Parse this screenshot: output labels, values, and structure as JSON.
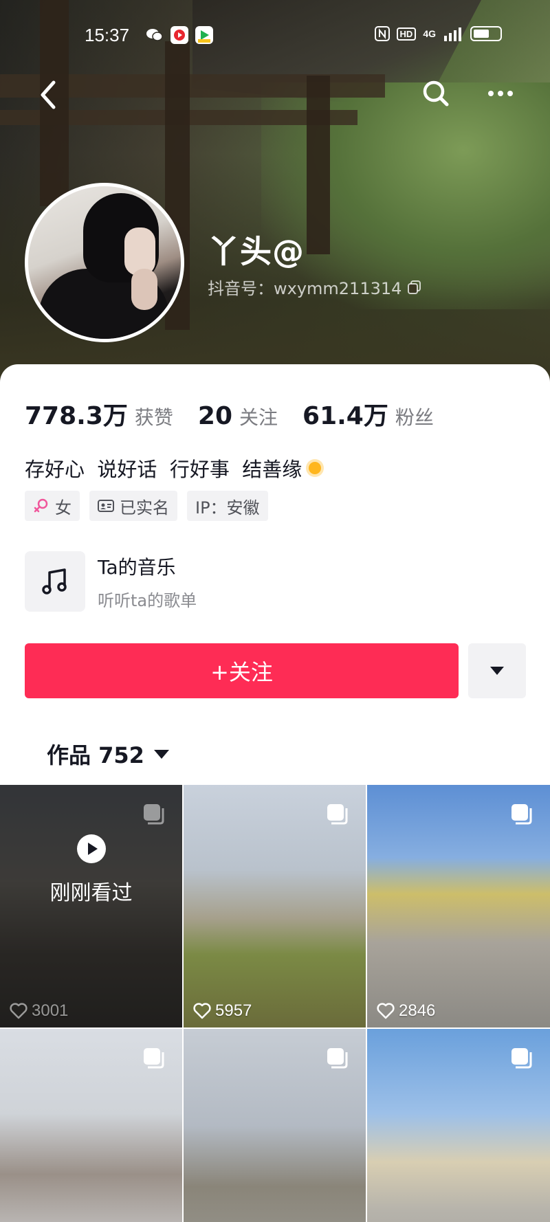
{
  "status_bar": {
    "time": "15:37",
    "network": "4G",
    "hd": "HD"
  },
  "profile": {
    "nickname": "丫头@",
    "douyin_id": "抖音号：wxymm211314",
    "stats": [
      {
        "value": "778.3万",
        "label": "获赞"
      },
      {
        "value": "20",
        "label": "关注"
      },
      {
        "value": "61.4万",
        "label": "粉丝"
      }
    ],
    "bio": "存好心  说好话  行好事  结善缘",
    "tags": [
      {
        "icon": "female-icon",
        "label": "女"
      },
      {
        "icon": "id-card-icon",
        "label": "已实名"
      },
      {
        "icon": "",
        "label": "IP：安徽"
      }
    ],
    "music": {
      "title": "Ta的音乐",
      "subtitle": "听听ta的歌单"
    },
    "follow_label": "+关注"
  },
  "works": {
    "tab_label": "作品 752",
    "items": [
      {
        "likes": "3001",
        "viewed": true,
        "viewed_label": "刚刚看过"
      },
      {
        "likes": "5957",
        "viewed": false
      },
      {
        "likes": "2846",
        "viewed": false
      },
      {
        "likes": "",
        "viewed": false
      },
      {
        "likes": "",
        "viewed": false
      },
      {
        "likes": "",
        "viewed": false
      }
    ]
  },
  "colors": {
    "accent": "#fe2c55",
    "text_primary": "#161823",
    "text_secondary": "#7a7b80"
  }
}
